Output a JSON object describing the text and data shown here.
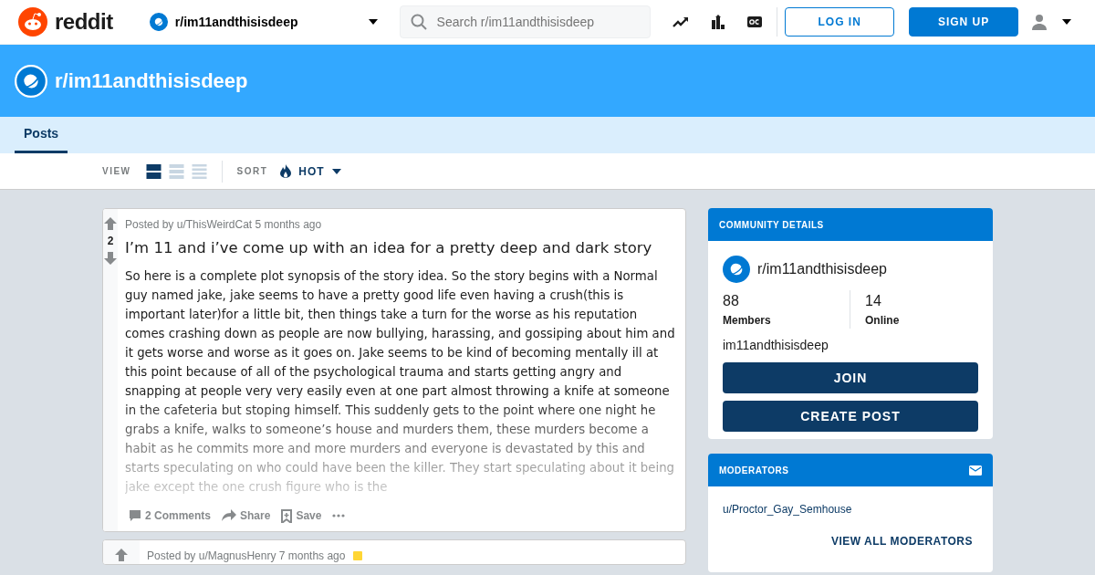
{
  "header": {
    "logo_text": "reddit",
    "community": "r/im11andthisisdeep",
    "search": {
      "placeholder": "Search r/im11andthisisdeep"
    },
    "login": "LOG IN",
    "signup": "SIGN UP"
  },
  "banner": {
    "title": "r/im11andthisisdeep"
  },
  "tabs": [
    {
      "label": "Posts",
      "selected": true
    }
  ],
  "view": {
    "label": "VIEW",
    "modes": [
      {
        "kind": "card",
        "selected": true
      },
      {
        "kind": "classic",
        "selected": false
      },
      {
        "kind": "compact",
        "selected": false
      }
    ]
  },
  "sort": {
    "label": "SORT",
    "value": "HOT"
  },
  "posts": [
    {
      "meta": "Posted by u/ThisWeirdCat 5 months ago",
      "score": "2",
      "title": "I’m 11 and i’ve come up with an idea for a pretty deep and dark story",
      "body": "So here is a complete plot synopsis of the story idea. So the story begins with a Normal guy named jake, jake seems to have a pretty good life even having a crush(this is important later)for a little bit, then things take a turn for the worse as his reputation comes crashing down as people are now bullying, harassing, and gossiping about him and it gets worse and worse as it goes on. Jake seems to be kind of becoming mentally ill at this point because of all of the psychological trauma and starts getting angry and snapping at people very very easily even at one part almost throwing a knife at someone in the cafeteria but stoping himself. This suddenly gets to the point where one night he grabs a knife, walks to someone’s house and murders them, these murders become a habit as he commits more and more murders and everyone is devastated by this and starts speculating on who could have been the killer. They start speculating about it being jake except the one crush figure who is the",
      "comments": "2 Comments",
      "share": "Share",
      "save": "Save",
      "award": false
    },
    {
      "meta": "Posted by u/MagnusHenry 7 months ago",
      "award": true
    }
  ],
  "sidebar": {
    "details": {
      "header": "COMMUNITY DETAILS",
      "name": "r/im11andthisisdeep",
      "stats": [
        {
          "value": "88",
          "label": "Members"
        },
        {
          "value": "14",
          "label": "Online"
        }
      ],
      "description": "im11andthisisdeep",
      "buttons": [
        "JOIN",
        "CREATE POST"
      ]
    },
    "moderators": {
      "header": "MODERATORS",
      "users": [
        "u/Proctor_Gay_Semhouse"
      ],
      "link": "VIEW ALL MODERATORS"
    }
  }
}
